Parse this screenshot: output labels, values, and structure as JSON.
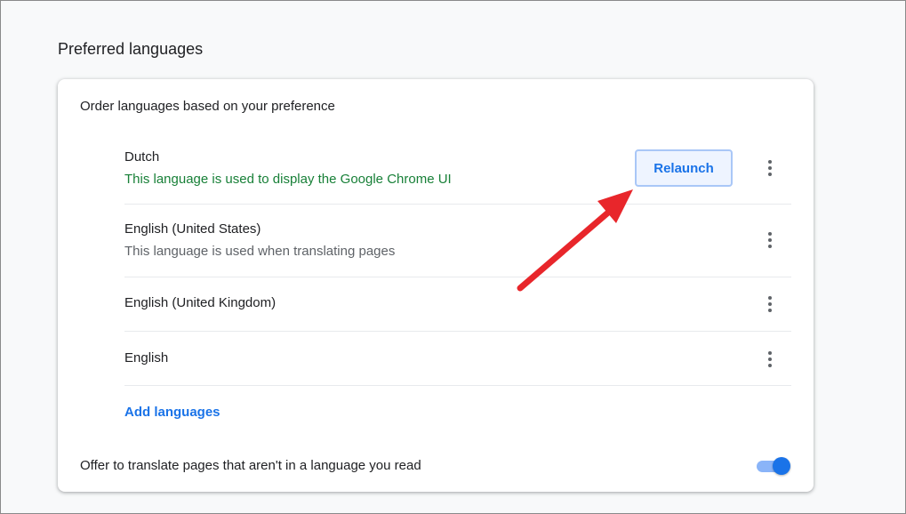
{
  "section": {
    "title": "Preferred languages"
  },
  "card": {
    "header": "Order languages based on your preference",
    "languages": [
      {
        "name": "Dutch",
        "subtitle": "This language is used to display the Google Chrome UI"
      },
      {
        "name": "English (United States)",
        "subtitle": "This language is used when translating pages"
      },
      {
        "name": "English (United Kingdom)",
        "subtitle": ""
      },
      {
        "name": "English",
        "subtitle": ""
      }
    ],
    "relaunch_label": "Relaunch",
    "add_languages_label": "Add languages",
    "offer_translate_label": "Offer to translate pages that aren't in a language you read",
    "offer_translate_enabled": true
  },
  "colors": {
    "accent": "#1a73e8",
    "ui_language_note": "#188038",
    "annotation_arrow": "#e8262b"
  },
  "icons": {
    "row_menu": "more-vert-icon",
    "annotation": "red-arrow-annotation"
  }
}
